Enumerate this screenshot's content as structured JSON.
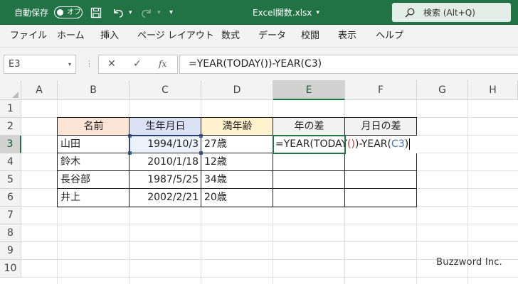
{
  "titlebar": {
    "autosave_label": "自動保存",
    "autosave_state": "オフ",
    "filename": "Excel関数.xlsx",
    "filename_caret": "▾",
    "undo_caret": "▾",
    "redo_caret": "▾",
    "qat_more": "▾",
    "search_placeholder": "検索 (Alt+Q)",
    "bg_color": "#217346"
  },
  "menu": [
    "ファイル",
    "ホーム",
    "挿入",
    "ページ レイアウト",
    "数式",
    "データ",
    "校閲",
    "表示",
    "ヘルプ"
  ],
  "formula_bar": {
    "name_box": "E3",
    "name_box_caret": "▾",
    "separator": "⋮",
    "cancel_glyph": "✕",
    "enter_glyph": "✓",
    "fx_glyph": "fx",
    "formula": "=YEAR(TODAY())-YEAR(C3)"
  },
  "grid": {
    "columns": [
      "A",
      "B",
      "C",
      "D",
      "E",
      "F",
      "G",
      "H"
    ],
    "selected_column": "E",
    "rows": [
      "1",
      "2",
      "3",
      "4",
      "5",
      "6",
      "7",
      "8",
      "9",
      "10"
    ],
    "selected_row": "3",
    "headers": {
      "name": "名前",
      "birthday": "生年月日",
      "age": "満年齢",
      "year_diff": "年の差",
      "md_diff": "月日の差"
    },
    "header_colors": {
      "name": "#fce4d6",
      "birthday": "#d9e1f2",
      "age": "#fff2cc",
      "year_diff": "#f2f2f2",
      "md_diff": "#f2f2f2"
    },
    "records": [
      {
        "name": "山田",
        "birthday": "1994/10/3",
        "age": "27歳"
      },
      {
        "name": "鈴木",
        "birthday": "2010/1/18",
        "age": "12歳"
      },
      {
        "name": "長谷部",
        "birthday": "1987/5/25",
        "age": "34歳"
      },
      {
        "name": "井上",
        "birthday": "2002/2/21",
        "age": "20歳"
      }
    ],
    "editing_cell": {
      "part1": "=YEAR(TODAY",
      "part2": "()",
      "part3": ")-YEAR(",
      "part4": "C3",
      "part5": ")"
    }
  },
  "watermark": "Buzzword Inc."
}
